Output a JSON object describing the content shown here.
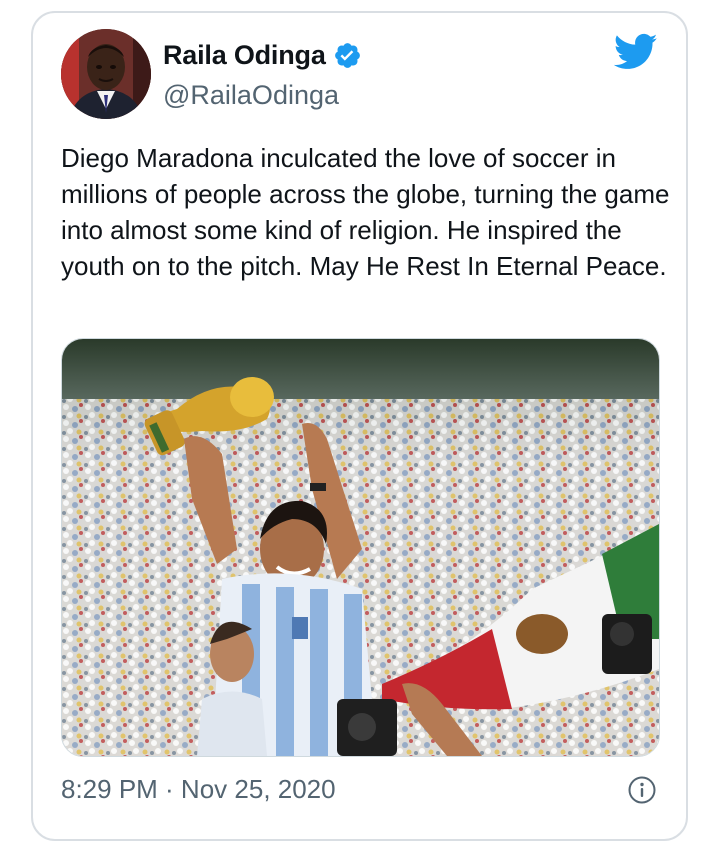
{
  "author": {
    "name": "Raila Odinga",
    "handle": "@RailaOdinga",
    "verified": true
  },
  "tweet": {
    "text": "Diego Maradona inculcated the love of soccer in millions of people across the globe, turning the game into almost some kind of religion. He inspired the youth on to the pitch. May He Rest In Eternal Peace.",
    "timestamp": "8:29 PM · Nov 25, 2020"
  },
  "icons": {
    "brand": "twitter-bird-icon",
    "verified": "verified-badge-icon",
    "info": "info-icon"
  },
  "colors": {
    "brand": "#1d9bf0",
    "secondary_text": "#536471",
    "border": "#d9dee3"
  }
}
